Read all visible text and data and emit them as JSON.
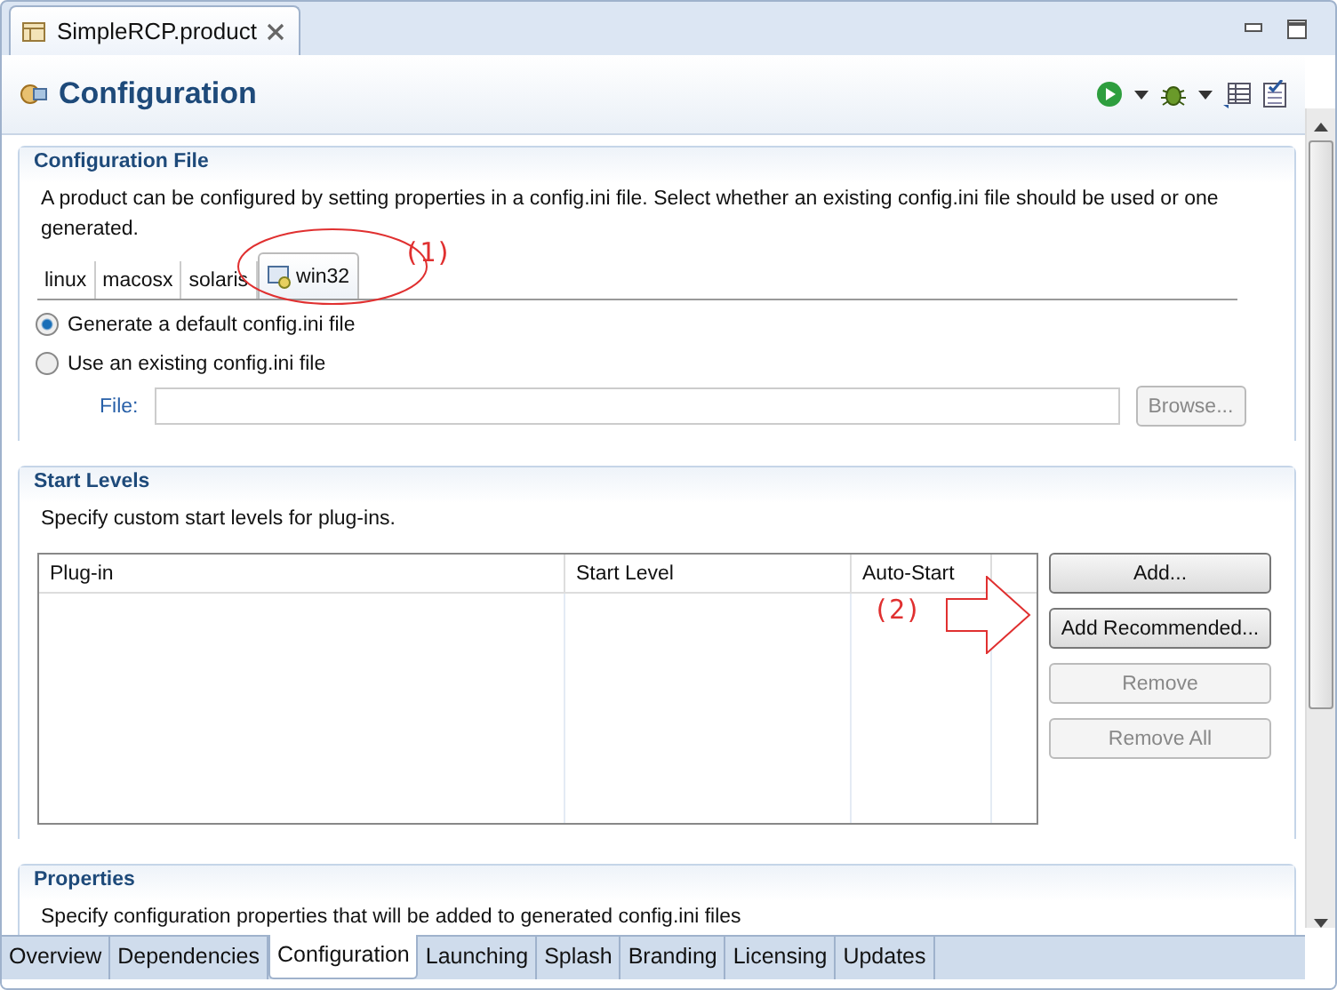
{
  "editor_tab": {
    "title": "SimpleRCP.product"
  },
  "page_title": "Configuration",
  "config_file": {
    "title": "Configuration File",
    "description": "A product can be configured by setting properties in a config.ini file.  Select whether an existing config.ini file should be used or one generated.",
    "os_tabs": [
      {
        "label": "linux",
        "selected": false
      },
      {
        "label": "macosx",
        "selected": false
      },
      {
        "label": "solaris",
        "selected": false
      },
      {
        "label": "win32",
        "selected": true
      }
    ],
    "options": [
      {
        "label": "Generate a default config.ini file",
        "selected": true
      },
      {
        "label": "Use an existing config.ini file",
        "selected": false
      }
    ],
    "file_label": "File:",
    "browse": {
      "label": "Browse...",
      "disabled": true
    }
  },
  "start_levels": {
    "title": "Start Levels",
    "description": "Specify custom start levels for plug-ins.",
    "columns": [
      "Plug-in",
      "Start Level",
      "Auto-Start"
    ],
    "buttons": [
      {
        "label": "Add...",
        "disabled": false
      },
      {
        "label": "Add Recommended...",
        "disabled": false
      },
      {
        "label": "Remove",
        "disabled": true
      },
      {
        "label": "Remove All",
        "disabled": true
      }
    ]
  },
  "properties": {
    "title": "Properties",
    "description": "Specify configuration properties that will be added to generated config.ini files"
  },
  "annotations": [
    {
      "label": "(1)"
    },
    {
      "label": "(2)"
    }
  ],
  "page_tabs": [
    {
      "label": "Overview",
      "selected": false
    },
    {
      "label": "Dependencies",
      "selected": false
    },
    {
      "label": "Configuration",
      "selected": true
    },
    {
      "label": "Launching",
      "selected": false
    },
    {
      "label": "Splash",
      "selected": false
    },
    {
      "label": "Branding",
      "selected": false
    },
    {
      "label": "Licensing",
      "selected": false
    },
    {
      "label": "Updates",
      "selected": false
    }
  ]
}
